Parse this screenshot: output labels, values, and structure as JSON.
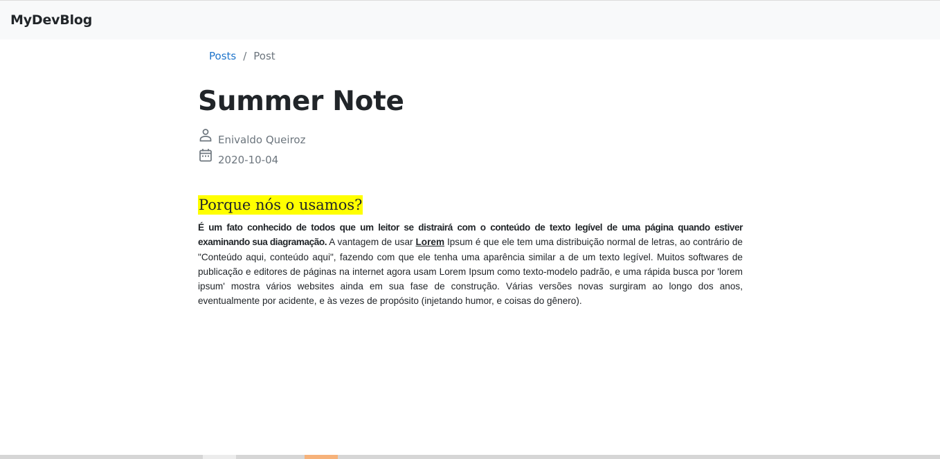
{
  "navbar": {
    "brand": "MyDevBlog"
  },
  "breadcrumb": {
    "items": [
      {
        "label": "Posts"
      },
      {
        "label": "Post"
      }
    ],
    "separator": "/"
  },
  "post": {
    "title": "Summer Note",
    "author": "Enivaldo Queiroz",
    "date": "2020-10-04",
    "heading": "Porque nós o usamos?",
    "bold_intro": "É um fato conhecido de todos que um leitor se distrairá com o conteúdo de texto legível de uma página quando estiver examinando sua diagramação.",
    "text_before_link": " A vantagem de usar ",
    "underlined_word": "Lorem",
    "text_after_link": " Ipsum é que ele tem uma distribuição normal de letras, ao contrário de \"Conteúdo aqui, conteúdo aqui\", fazendo com que ele tenha uma aparência similar a de um texto legível. Muitos softwares de publicação e editores de páginas na internet agora usam Lorem Ipsum como texto-modelo padrão, e uma rápida busca por 'lorem ipsum' mostra vários websites ainda em sua fase de construção. Várias versões novas surgiram ao longo dos anos, eventualmente por acidente, e às vezes de propósito (injetando humor, e coisas do gênero)."
  },
  "icons": {
    "author": "person-icon",
    "date": "calendar-icon"
  },
  "colors": {
    "link": "#1f75cb",
    "highlight": "#ffff00",
    "muted": "#6c757d",
    "navbar_bg": "#f8f9fa"
  }
}
